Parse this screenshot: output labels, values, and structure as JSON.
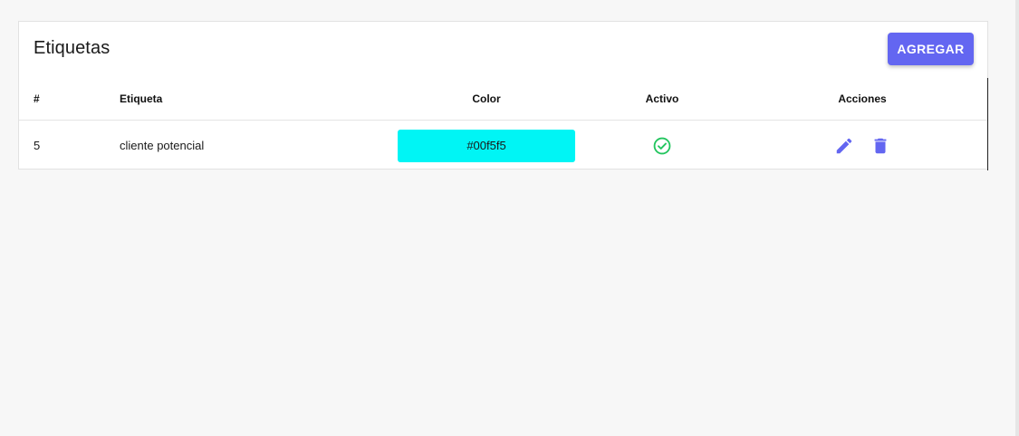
{
  "card": {
    "title": "Etiquetas",
    "add_label": "AGREGAR"
  },
  "table": {
    "columns": [
      "#",
      "Etiqueta",
      "Color",
      "Activo",
      "Acciones"
    ],
    "rows": [
      {
        "id": "5",
        "label": "cliente potencial",
        "color": "#00f5f5",
        "color_text": "#00f5f5",
        "active": true,
        "actions": [
          "edit-icon",
          "delete-icon"
        ]
      }
    ]
  },
  "colors": {
    "accent": "#6366f1",
    "active_green": "#22c55e"
  }
}
